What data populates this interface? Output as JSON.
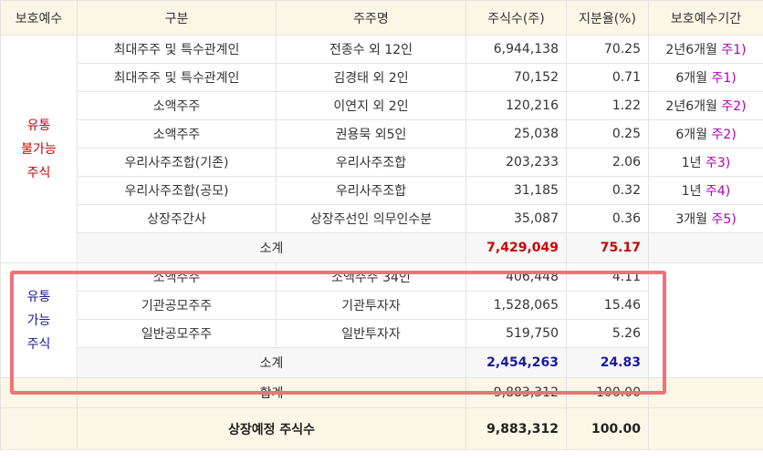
{
  "headers": [
    "보호예수",
    "구분",
    "주주명",
    "주식수(주)",
    "지분율(%)",
    "보호예수기간"
  ],
  "locked_group": {
    "label_lines": [
      "유통",
      "불가능",
      "주식"
    ],
    "rows": [
      {
        "type": "최대주주 및 특수관계인",
        "holder": "전종수 외 12인",
        "shares": "6,944,138",
        "ratio": "70.25",
        "period": "2년6개월",
        "note": "주1)"
      },
      {
        "type": "최대주주 및 특수관계인",
        "holder": "김경태 외 2인",
        "shares": "70,152",
        "ratio": "0.71",
        "period": "6개월",
        "note": "주1)"
      },
      {
        "type": "소액주주",
        "holder": "이연지 외 2인",
        "shares": "120,216",
        "ratio": "1.22",
        "period": "2년6개월",
        "note": "주2)"
      },
      {
        "type": "소액주주",
        "holder": "권용묵 외5인",
        "shares": "25,038",
        "ratio": "0.25",
        "period": "6개월",
        "note": "주2)"
      },
      {
        "type": "우리사주조합(기존)",
        "holder": "우리사주조합",
        "shares": "203,233",
        "ratio": "2.06",
        "period": "1년",
        "note": "주3)"
      },
      {
        "type": "우리사주조합(공모)",
        "holder": "우리사주조합",
        "shares": "31,185",
        "ratio": "0.32",
        "period": "1년",
        "note": "주4)"
      },
      {
        "type": "상장주간사",
        "holder": "상장주선인 의무인수분",
        "shares": "35,087",
        "ratio": "0.36",
        "period": "3개월",
        "note": "주5)"
      }
    ],
    "subtotal": {
      "label": "소계",
      "shares": "7,429,049",
      "ratio": "75.17"
    }
  },
  "tradable_group": {
    "label_lines": [
      "유통",
      "가능",
      "주식"
    ],
    "rows": [
      {
        "type": "소액주주",
        "holder": "소액주주 34인",
        "shares": "406,448",
        "ratio": "4.11"
      },
      {
        "type": "기관공모주주",
        "holder": "기관투자자",
        "shares": "1,528,065",
        "ratio": "15.46"
      },
      {
        "type": "일반공모주주",
        "holder": "일반투자자",
        "shares": "519,750",
        "ratio": "5.26"
      }
    ],
    "subtotal": {
      "label": "소계",
      "shares": "2,454,263",
      "ratio": "24.83"
    }
  },
  "total": {
    "label": "합계",
    "shares": "9,883,312",
    "ratio": "100.00"
  },
  "listed": {
    "label": "상장예정 주식수",
    "shares": "9,883,312",
    "ratio": "100.00"
  },
  "colors": {
    "header_bg": "#fbf7e6",
    "locked_text": "#cc0000",
    "tradable_text": "#1a1aa0",
    "note_text": "#b000b0",
    "highlight_border": "#f07278"
  }
}
